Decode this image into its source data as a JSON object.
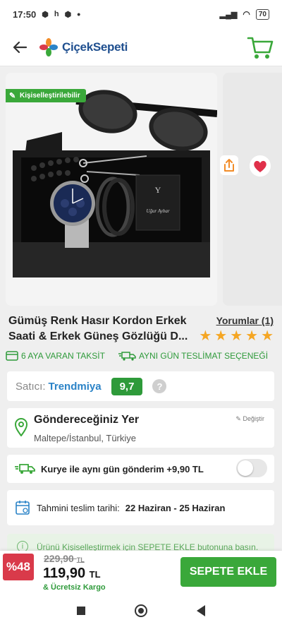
{
  "status": {
    "time": "17:50",
    "battery": "70"
  },
  "app": {
    "logo_text": "ÇiçekSepeti"
  },
  "product": {
    "badge": "Kişiselleştirilebilir",
    "title": "Gümüş Renk Hasır Kordon Erkek Saati & Erkek Güneş Gözlüğü D...",
    "reviews_label": "Yorumlar (1)",
    "rating": 5,
    "promos": [
      "6 AYA VARAN TAKSİT",
      "AYNI GÜN TESLİMAT SEÇENEĞİ"
    ],
    "card_text_top": "Y",
    "card_text_bottom": "Uğur Aybar"
  },
  "seller": {
    "label": "Satıcı:",
    "name": "Trendmiya",
    "score": "9,7",
    "help": "?"
  },
  "address": {
    "title": "Göndereceğiniz Yer",
    "value": "Maltepe/İstanbul, Türkiye",
    "change_label": "Değiştir"
  },
  "courier": {
    "label": "Kurye ile aynı gün gönderim +9,90 TL",
    "enabled": false
  },
  "delivery": {
    "label": "Tahmini teslim tarihi:",
    "value": "22 Haziran - 25 Haziran"
  },
  "info": {
    "text": "Ürünü Kişiselleştirmek için SEPETE EKLE butonuna basın."
  },
  "pricing": {
    "discount": "%48",
    "old_price": "229,90",
    "old_currency": "TL",
    "new_price": "119,90",
    "new_currency": "TL",
    "shipping": "& Ücretsiz Kargo",
    "buy_label": "SEPETE EKLE"
  },
  "colors": {
    "green": "#3aa83a",
    "red": "#d93a4a",
    "blue": "#2b83c7",
    "star": "#f5a623"
  }
}
